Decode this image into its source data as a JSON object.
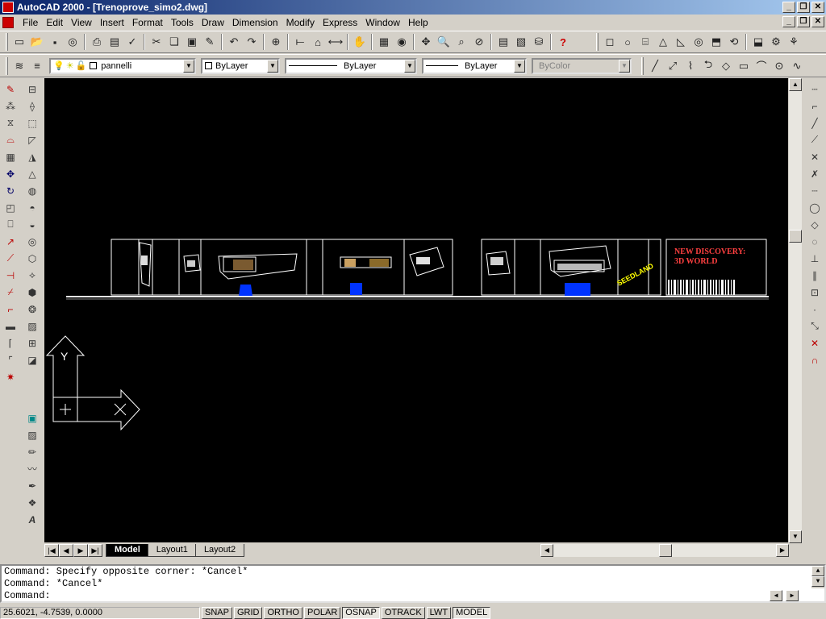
{
  "window": {
    "title": "AutoCAD 2000 - [Trenoprove_simo2.dwg]",
    "controls": [
      "_",
      "❐",
      "✕"
    ]
  },
  "menu": [
    "File",
    "Edit",
    "View",
    "Insert",
    "Format",
    "Tools",
    "Draw",
    "Dimension",
    "Modify",
    "Express",
    "Window",
    "Help"
  ],
  "properties_bar": {
    "layer": "pannelli",
    "color": "ByLayer",
    "linetype": "ByLayer",
    "lineweight": "ByLayer",
    "plotstyle": "ByColor"
  },
  "drawing": {
    "sign_line1": "NEW DISCOVERY:",
    "sign_line2": "3D WORLD",
    "slanted_text": "SEEDLAND",
    "ucs_y": "Y",
    "ucs_x": "X"
  },
  "tabs": [
    "Model",
    "Layout1",
    "Layout2"
  ],
  "command": {
    "line1": "Command: Specify opposite corner: *Cancel*",
    "line2": "Command: *Cancel*",
    "prompt": "Command:"
  },
  "status": {
    "coords": "25.6021, -4.7539, 0.0000",
    "buttons": [
      "SNAP",
      "GRID",
      "ORTHO",
      "POLAR",
      "OSNAP",
      "OTRACK",
      "LWT",
      "MODEL"
    ],
    "pressed": [
      "OSNAP",
      "MODEL"
    ]
  },
  "colors": {
    "drawing_bg": "#000000",
    "sign_text": "#ff4040",
    "accent_blue": "#0033ff",
    "slanted_yellow": "#ffff00"
  }
}
